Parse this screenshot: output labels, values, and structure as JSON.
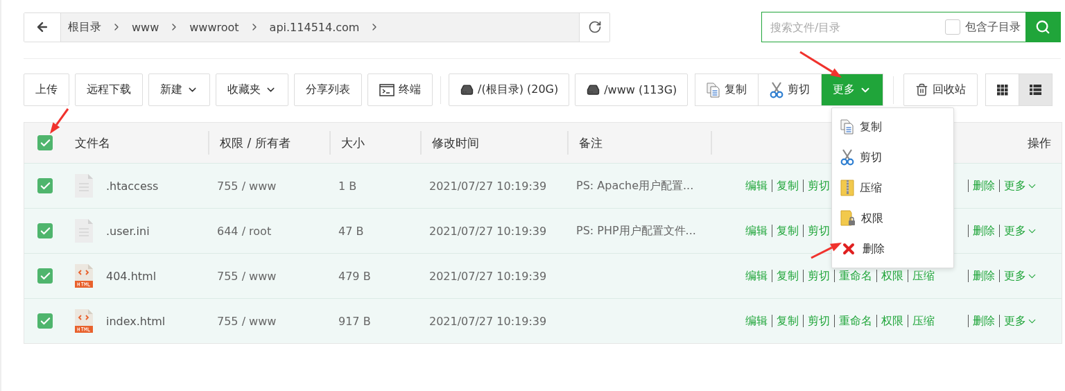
{
  "breadcrumb": {
    "segments": [
      "根目录",
      "www",
      "wwwroot",
      "api.114514.com"
    ]
  },
  "search": {
    "placeholder": "搜索文件/目录",
    "include_subdirs": {
      "label": "包含子目录",
      "checked": false
    }
  },
  "toolbar": [
    {
      "kind": "button",
      "label": "上传"
    },
    {
      "kind": "button",
      "label": "远程下载"
    },
    {
      "kind": "dropdown",
      "label": "新建"
    },
    {
      "kind": "dropdown",
      "label": "收藏夹"
    },
    {
      "kind": "button",
      "label": "分享列表"
    },
    {
      "kind": "terminal",
      "label": "终端"
    },
    {
      "kind": "disk",
      "label": "/(根目录) (20G)"
    },
    {
      "kind": "disk",
      "label": "/www (113G)"
    }
  ],
  "batch_group": [
    {
      "kind": "copy",
      "label": "复制",
      "selected": false
    },
    {
      "kind": "cut",
      "label": "剪切",
      "selected": false
    },
    {
      "kind": "more",
      "label": "更多",
      "selected": true
    }
  ],
  "recycle_bin": {
    "label": "回收站"
  },
  "view_modes": [
    {
      "kind": "grid",
      "selected": false
    },
    {
      "kind": "list",
      "selected": true
    }
  ],
  "dropdown_menu": [
    {
      "kind": "copy",
      "label": "复制"
    },
    {
      "kind": "cut",
      "label": "剪切"
    },
    {
      "kind": "zip",
      "label": "压缩"
    },
    {
      "kind": "lock",
      "label": "权限"
    },
    {
      "kind": "delete",
      "label": "删除"
    }
  ],
  "table": {
    "select_all": true,
    "columns": [
      "文件名",
      "权限 / 所有者",
      "大小",
      "修改时间",
      "备注",
      "操作"
    ],
    "rows": [
      {
        "checked": true,
        "kind": "text",
        "name": ".htaccess",
        "permission": "755 / www",
        "size": "1 B",
        "modified": "2021/07/27 10:19:39",
        "note": "PS: Apache用户配置...",
        "actions": [
          {
            "label": "编辑"
          },
          {
            "label": "复制"
          },
          {
            "label": "剪切"
          },
          {
            "label": "删除"
          },
          {
            "label": "更多"
          }
        ]
      },
      {
        "checked": true,
        "kind": "text",
        "name": ".user.ini",
        "permission": "644 / root",
        "size": "47 B",
        "modified": "2021/07/27 10:19:39",
        "note": "PS: PHP用户配置文件...",
        "actions": [
          {
            "label": "编辑"
          },
          {
            "label": "复制"
          },
          {
            "label": "剪切"
          },
          {
            "label": "删除"
          },
          {
            "label": "更多"
          }
        ]
      },
      {
        "checked": true,
        "kind": "html",
        "name": "404.html",
        "permission": "755 / www",
        "size": "479 B",
        "modified": "2021/07/27 10:19:39",
        "actions": [
          {
            "label": "编辑"
          },
          {
            "label": "复制"
          },
          {
            "label": "剪切"
          },
          {
            "label": "重命名"
          },
          {
            "label": "权限"
          },
          {
            "label": "压缩"
          },
          {
            "label": "删除"
          },
          {
            "label": "更多"
          }
        ]
      },
      {
        "checked": true,
        "kind": "html",
        "name": "index.html",
        "permission": "755 / www",
        "size": "917 B",
        "modified": "2021/07/27 10:19:39",
        "actions": [
          {
            "label": "编辑"
          },
          {
            "label": "复制"
          },
          {
            "label": "剪切"
          },
          {
            "label": "重命名"
          },
          {
            "label": "权限"
          },
          {
            "label": "压缩"
          },
          {
            "label": "删除"
          },
          {
            "label": "更多"
          }
        ]
      }
    ]
  }
}
